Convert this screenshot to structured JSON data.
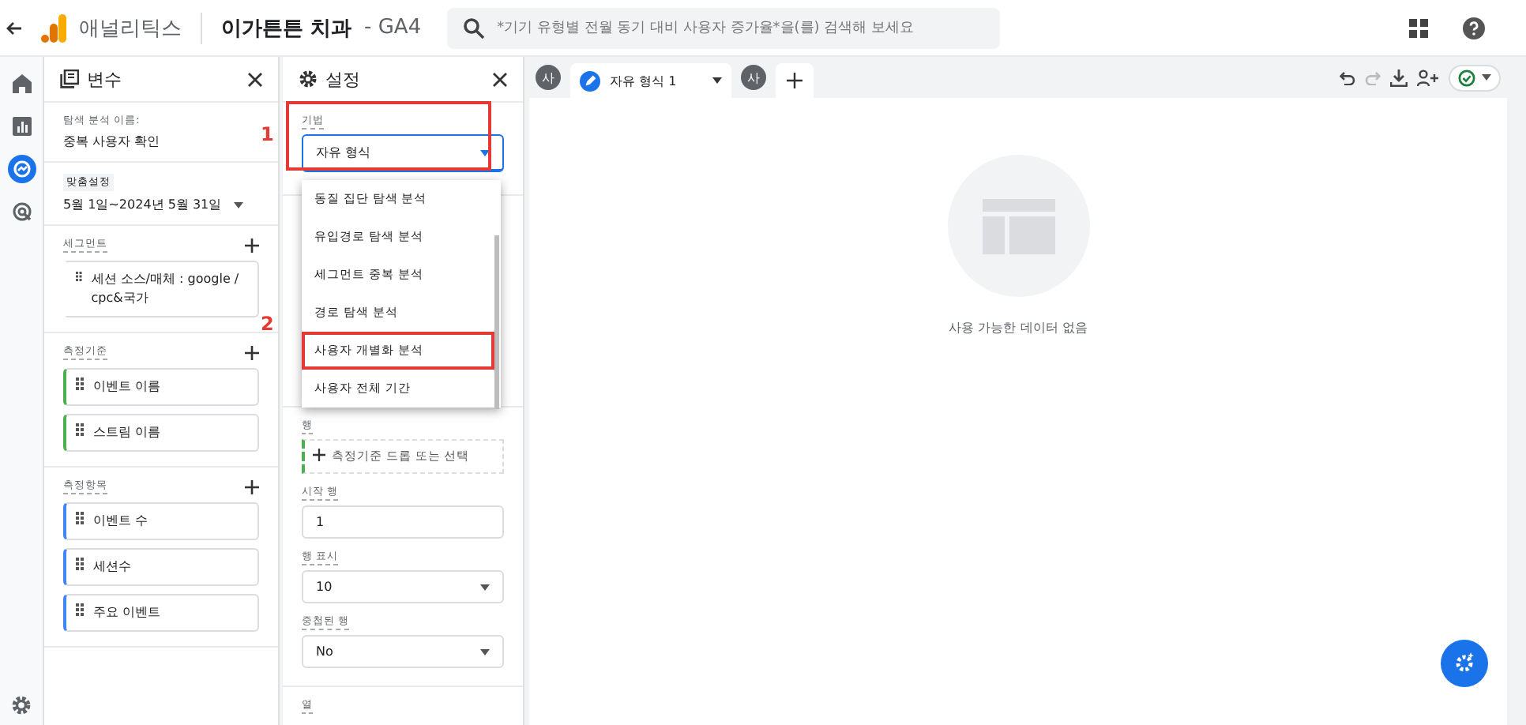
{
  "header": {
    "app_name": "애널리틱스",
    "property": "이가튼튼 치과",
    "property_suffix": "- GA4",
    "search": {
      "placeholder": "*기기 유형별 전월 동기 대비 사용자 증가율*을(를) 검색해 보세요"
    }
  },
  "rail": [
    {
      "kind": "home",
      "selected": false
    },
    {
      "kind": "reports",
      "selected": false
    },
    {
      "kind": "explore",
      "selected": true
    },
    {
      "kind": "ads",
      "selected": false
    }
  ],
  "variables": {
    "title": "변수",
    "name_label": "탐색 분석 이름:",
    "name_value": "중복 사용자 확인",
    "date_label": "맞춤설정",
    "date_value": "5월 1일~2024년 5월 31일",
    "sections": [
      {
        "title": "세그먼트",
        "kind": "segment",
        "items": [
          "세션 소스/매체 : google / cpc&국가"
        ]
      },
      {
        "title": "측정기준",
        "kind": "dimension",
        "items": [
          "이벤트 이름",
          "스트림 이름"
        ]
      },
      {
        "title": "측정항목",
        "kind": "metric",
        "items": [
          "이벤트 수",
          "세션수",
          "주요 이벤트"
        ]
      }
    ]
  },
  "settings": {
    "title": "설정",
    "technique_label": "기법",
    "technique_value": "자유 형식",
    "options": [
      {
        "label": "동질 집단 탐색 분석",
        "highlighted": false
      },
      {
        "label": "유입경로 탐색 분석",
        "highlighted": false
      },
      {
        "label": "세그먼트 중복 분석",
        "highlighted": false
      },
      {
        "label": "경로 탐색 분석",
        "highlighted": false
      },
      {
        "label": "사용자 개별화 분석",
        "highlighted": true
      },
      {
        "label": "사용자 전체 기간",
        "highlighted": false
      }
    ],
    "rows_label": "행",
    "rows_drop": "측정기준 드롭 또는 선택",
    "start_row_label": "시작 행",
    "start_row": "1",
    "show_rows_label": "행 표시",
    "show_rows": "10",
    "nested_label": "중첩된 행",
    "nested": "No",
    "columns_label": "열"
  },
  "annotations": [
    "1",
    "2"
  ],
  "tabs": [
    {
      "avatar": "사",
      "label": "자유 형식 1",
      "selected": true
    }
  ],
  "tab_avatar": "사",
  "canvas": {
    "empty_text": "사용 가능한 데이터 없음"
  }
}
